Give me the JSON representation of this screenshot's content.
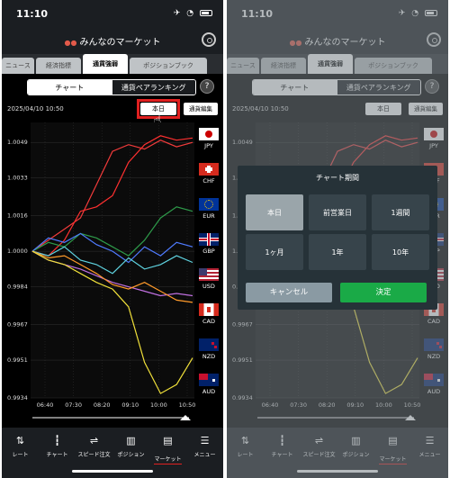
{
  "status_bar": {
    "time": "11:10"
  },
  "app": {
    "title": "みんなのマーケット"
  },
  "tabs": [
    "ニュース",
    "経済指標",
    "通貨強弱",
    "ポジションブック"
  ],
  "segments": {
    "chart": "チャート",
    "ranking": "通貨ペアランキング"
  },
  "help_label": "?",
  "date_label": "2025/04/10 10:50",
  "buttons": {
    "today": "本日",
    "edit": "通貨編集"
  },
  "flags": [
    {
      "code": "JPY",
      "color": "#f23b3b"
    },
    {
      "code": "CHF",
      "color": "#ff3030"
    },
    {
      "code": "EUR",
      "color": "#2e9b4a"
    },
    {
      "code": "GBP",
      "color": "#4f7bff"
    },
    {
      "code": "USD",
      "color": "#5fd3e0"
    },
    {
      "code": "CAD",
      "color": "#c070e0"
    },
    {
      "code": "NZD",
      "color": "#ff9a2a"
    },
    {
      "code": "AUD",
      "color": "#f0e03a"
    }
  ],
  "nav": [
    {
      "label": "レート",
      "icon": "rate-icon"
    },
    {
      "label": "チャート",
      "icon": "chart-icon"
    },
    {
      "label": "スピード注文",
      "icon": "speed-order-icon"
    },
    {
      "label": "ポジション",
      "icon": "position-icon"
    },
    {
      "label": "マーケット",
      "icon": "market-icon"
    },
    {
      "label": "メニュー",
      "icon": "menu-icon"
    }
  ],
  "modal": {
    "title": "チャート期間",
    "options": [
      "本日",
      "前営業日",
      "1週間",
      "1ヶ月",
      "1年",
      "10年"
    ],
    "selected": "本日",
    "cancel": "キャンセル",
    "ok": "決定"
  },
  "chart_data": {
    "type": "line",
    "x": [
      "06:40",
      "07:30",
      "08:20",
      "09:10",
      "10:00",
      "10:50"
    ],
    "ylim": [
      0.9934,
      1.0058
    ],
    "yticks": [
      "1.0049",
      "1.0033",
      "1.0016",
      "1.0000",
      "0.9984",
      "0.9967",
      "0.9951",
      "0.9934"
    ],
    "series": [
      {
        "name": "JPY",
        "color": "#f23b3b",
        "values": [
          1.0,
          1.0005,
          1.001,
          1.0015,
          1.003,
          1.0045,
          1.0048,
          1.0046,
          1.005,
          1.0047,
          1.0049
        ]
      },
      {
        "name": "CHF",
        "color": "#ff3030",
        "values": [
          1.0,
          0.9998,
          1.0005,
          1.0018,
          1.002,
          1.0025,
          1.004,
          1.0048,
          1.0052,
          1.005,
          1.0051
        ]
      },
      {
        "name": "EUR",
        "color": "#2e9b4a",
        "values": [
          1.0,
          1.0004,
          1.0002,
          1.0008,
          1.0006,
          1.0002,
          0.9998,
          1.0005,
          1.0015,
          1.002,
          1.0018
        ]
      },
      {
        "name": "GBP",
        "color": "#4f7bff",
        "values": [
          1.0,
          1.0006,
          1.0004,
          1.0008,
          1.0003,
          1.0,
          0.9995,
          1.0002,
          0.9998,
          1.0004,
          1.0002
        ]
      },
      {
        "name": "USD",
        "color": "#5fd3e0",
        "values": [
          1.0,
          0.9998,
          1.0002,
          0.9996,
          0.9994,
          0.999,
          0.9997,
          0.9992,
          0.9994,
          0.9998,
          0.9995
        ]
      },
      {
        "name": "CAD",
        "color": "#c070e0",
        "values": [
          1.0,
          0.9996,
          0.9994,
          0.9992,
          0.9989,
          0.9986,
          0.9984,
          0.9982,
          0.998,
          0.9981,
          0.998
        ]
      },
      {
        "name": "NZD",
        "color": "#ff9a2a",
        "values": [
          1.0,
          0.9997,
          0.9998,
          0.9994,
          0.999,
          0.9985,
          0.9983,
          0.9986,
          0.9982,
          0.9978,
          0.9977
        ]
      },
      {
        "name": "AUD",
        "color": "#f0e03a",
        "values": [
          1.0,
          0.9996,
          0.9994,
          0.999,
          0.9986,
          0.9983,
          0.9975,
          0.995,
          0.9936,
          0.994,
          0.9952
        ]
      }
    ]
  }
}
